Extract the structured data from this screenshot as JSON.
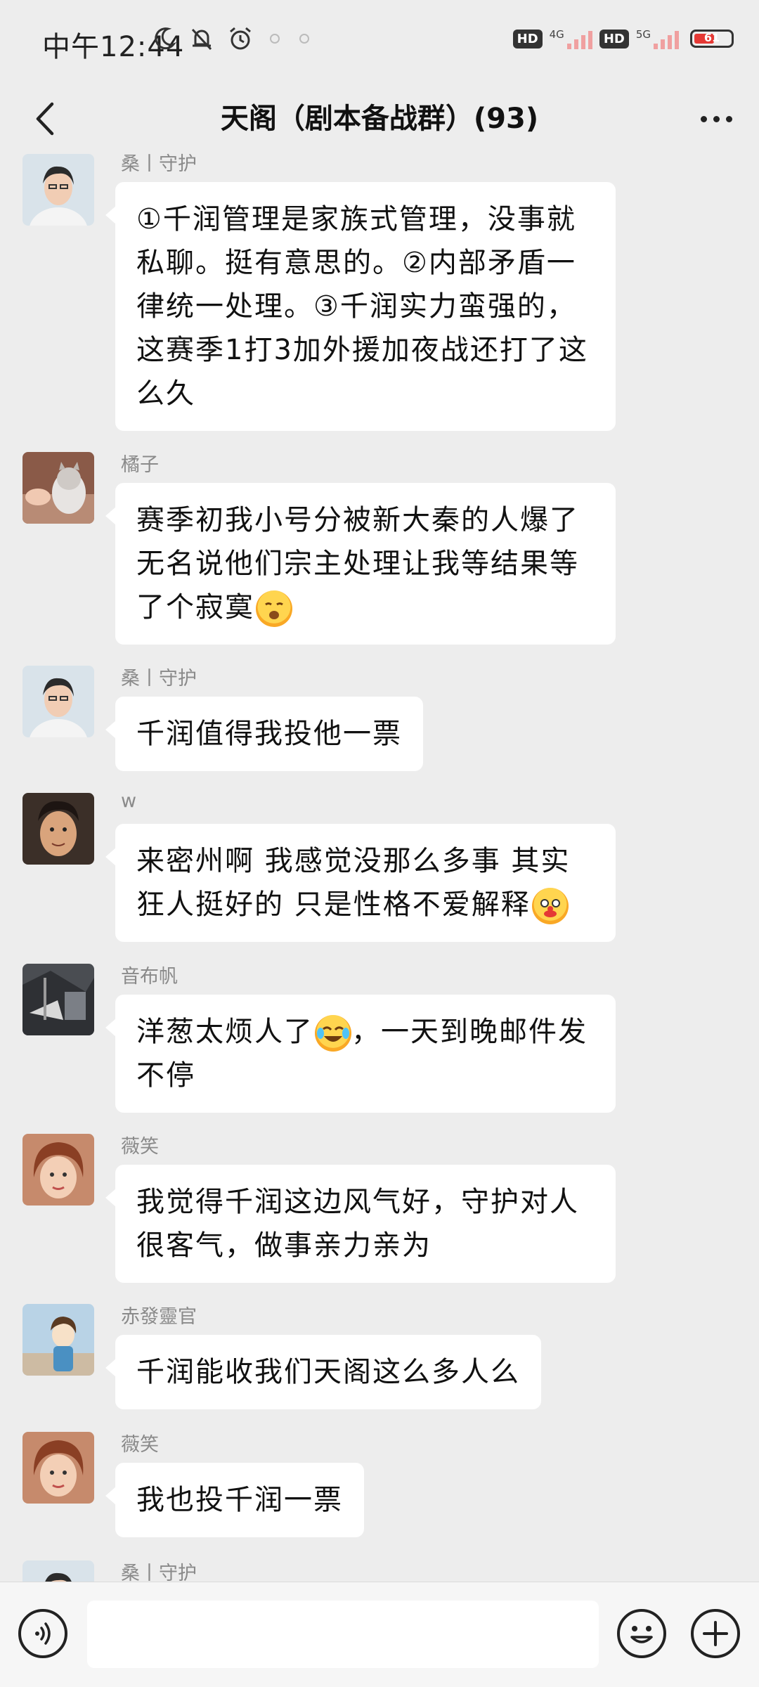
{
  "status_bar": {
    "time": "中午12:44",
    "hd1": "HD",
    "net1": "4G",
    "hd2": "HD",
    "net2": "5G",
    "battery": "61",
    "battery_level": 0.61
  },
  "nav": {
    "title": "天阁（剧本备战群）(93)"
  },
  "messages": [
    {
      "sender": "桑丨守护",
      "text": "①千润管理是家族式管理，没事就私聊。挺有意思的。②内部矛盾一律统一处理。③千润实力蛮强的，这赛季1打3加外援加夜战还打了这么久",
      "emoji": "",
      "avatar": "man-glasses"
    },
    {
      "sender": "橘子",
      "text": "赛季初我小号分被新大秦的人爆了无名说他们宗主处理让我等结果等了个寂寞",
      "emoji": "sad-face",
      "avatar": "cat"
    },
    {
      "sender": "桑丨守护",
      "text": "千润值得我投他一票",
      "emoji": "",
      "avatar": "man-glasses"
    },
    {
      "sender": "w",
      "text": "来密州啊 我感觉没那么多事 其实狂人挺好的 只是性格不爱解释",
      "emoji": "clown-face",
      "avatar": "boy"
    },
    {
      "sender": "音布帆",
      "text": "洋葱太烦人了",
      "text2": "，一天到晚邮件发不停",
      "emoji": "laughing-tears",
      "avatar": "dark-scene"
    },
    {
      "sender": "薇笑",
      "text": "我觉得千润这边风气好，守护对人很客气，做事亲力亲为",
      "emoji": "",
      "avatar": "woman"
    },
    {
      "sender": "赤發靈官",
      "text": "千润能收我们天阁这么多人么",
      "emoji": "",
      "avatar": "anime"
    },
    {
      "sender": "薇笑",
      "text": "我也投千润一票",
      "emoji": "",
      "avatar": "woman"
    },
    {
      "sender": "桑丨守护",
      "text": "",
      "emoji": "",
      "avatar": "man-glasses"
    }
  ],
  "input": {
    "placeholder": ""
  },
  "icons": {
    "back": "chevron-left-icon",
    "more": "more-dots-icon",
    "voice": "voice-icon",
    "emoji": "smiley-icon",
    "plus": "plus-icon"
  }
}
